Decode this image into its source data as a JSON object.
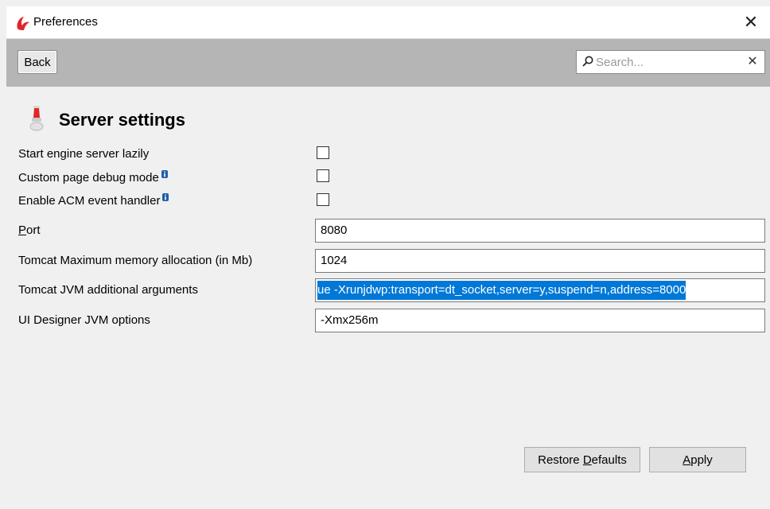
{
  "window": {
    "title": "Preferences",
    "close_glyph": "✕"
  },
  "toolbar": {
    "back_label": "Back",
    "search": {
      "placeholder": "Search...",
      "value": "",
      "clear_glyph": "✕"
    }
  },
  "section": {
    "icon": "server-icon",
    "title": "Server settings"
  },
  "settings": {
    "start_lazily": {
      "label": "Start engine server lazily",
      "checked": false
    },
    "custom_page_debug": {
      "label": "Custom page debug mode",
      "checked": false,
      "has_info_icon": true
    },
    "acm_event_handler": {
      "label": "Enable ACM event handler",
      "checked": false,
      "has_info_icon": true
    },
    "port": {
      "label_first": "P",
      "label_rest": "ort",
      "value": "8080"
    },
    "tomcat_memory": {
      "label": "Tomcat Maximum memory allocation (in Mb)",
      "value": "1024"
    },
    "tomcat_jvm_args": {
      "label": "Tomcat JVM additional arguments",
      "value": "ue -Xrunjdwp:transport=dt_socket,server=y,suspend=n,address=8000"
    },
    "ui_designer_jvm": {
      "label": "UI Designer JVM options",
      "value": "-Xmx256m"
    }
  },
  "buttons": {
    "restore_pre": "Restore ",
    "restore_mnemonic": "D",
    "restore_post": "efaults",
    "apply_mnemonic": "A",
    "apply_post": "pply"
  },
  "colors": {
    "selection": "#0078d7",
    "toolbar": "#b5b5b5",
    "brand": "#e0262b"
  }
}
